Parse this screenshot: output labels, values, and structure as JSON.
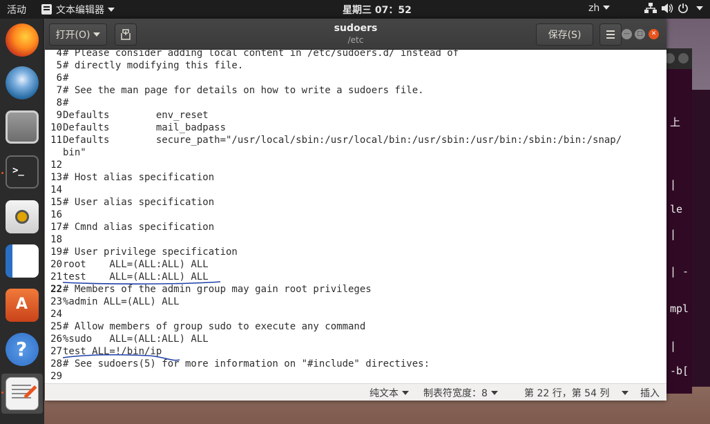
{
  "topbar": {
    "activities": "活动",
    "app_name": "文本编辑器",
    "clock": "星期三 07：52",
    "input_method": "zh"
  },
  "dock": {
    "items": [
      {
        "name": "firefox",
        "color": "#e66000"
      },
      {
        "name": "thunderbird",
        "color": "#2a6ea6"
      },
      {
        "name": "files",
        "color": "#8b8b8b"
      },
      {
        "name": "terminal",
        "color": "#2d2d2d"
      },
      {
        "name": "rhythmbox",
        "color": "#e0e0e0"
      },
      {
        "name": "libreoffice-writer",
        "color": "#2a6fc4"
      },
      {
        "name": "software-center",
        "color": "#e9541d"
      },
      {
        "name": "help",
        "color": "#3a7bd5"
      },
      {
        "name": "text-editor",
        "color": "#f2f2f2"
      }
    ]
  },
  "window": {
    "open_label": "打开(O)",
    "save_label": "保存(S)",
    "title": "sudoers",
    "subtitle": "/etc"
  },
  "editor": {
    "current_line": 22,
    "lines": [
      {
        "n": "4",
        "text": "# Please consider adding local content in /etc/sudoers.d/ instead of"
      },
      {
        "n": "5",
        "text": "# directly modifying this file."
      },
      {
        "n": "6",
        "text": "#"
      },
      {
        "n": "7",
        "text": "# See the man page for details on how to write a sudoers file."
      },
      {
        "n": "8",
        "text": "#"
      },
      {
        "n": "9",
        "text": "Defaults        env_reset"
      },
      {
        "n": "10",
        "text": "Defaults        mail_badpass"
      },
      {
        "n": "11",
        "text": "Defaults        secure_path=\"/usr/local/sbin:/usr/local/bin:/usr/sbin:/usr/bin:/sbin:/bin:/snap/"
      },
      {
        "n": "",
        "text": "bin\""
      },
      {
        "n": "12",
        "text": ""
      },
      {
        "n": "13",
        "text": "# Host alias specification"
      },
      {
        "n": "14",
        "text": ""
      },
      {
        "n": "15",
        "text": "# User alias specification"
      },
      {
        "n": "16",
        "text": ""
      },
      {
        "n": "17",
        "text": "# Cmnd alias specification"
      },
      {
        "n": "18",
        "text": ""
      },
      {
        "n": "19",
        "text": "# User privilege specification"
      },
      {
        "n": "20",
        "text": "root    ALL=(ALL:ALL) ALL"
      },
      {
        "n": "21",
        "text": "test    ALL=(ALL:ALL) ALL"
      },
      {
        "n": "22",
        "text": "# Members of the admin group may gain root privileges"
      },
      {
        "n": "23",
        "text": "%admin ALL=(ALL) ALL"
      },
      {
        "n": "24",
        "text": ""
      },
      {
        "n": "25",
        "text": "# Allow members of group sudo to execute any command"
      },
      {
        "n": "26",
        "text": "%sudo   ALL=(ALL:ALL) ALL"
      },
      {
        "n": "27",
        "text": "test ALL=!/bin/ip"
      },
      {
        "n": "28",
        "text": "# See sudoers(5) for more information on \"#include\" directives:"
      },
      {
        "n": "29",
        "text": ""
      }
    ]
  },
  "statusbar": {
    "syntax": "纯文本",
    "tab_width": "制表符宽度：8",
    "position": "第 22 行，第 54 列",
    "mode": "插入"
  },
  "background_terminal": {
    "fragments": [
      "上",
      "|",
      "le",
      "|",
      "| -",
      "mpl",
      "|",
      "-b["
    ]
  },
  "colors": {
    "accent": "#e9541d",
    "annotation": "#1f3fa8",
    "terminal_bg": "#300a24"
  }
}
